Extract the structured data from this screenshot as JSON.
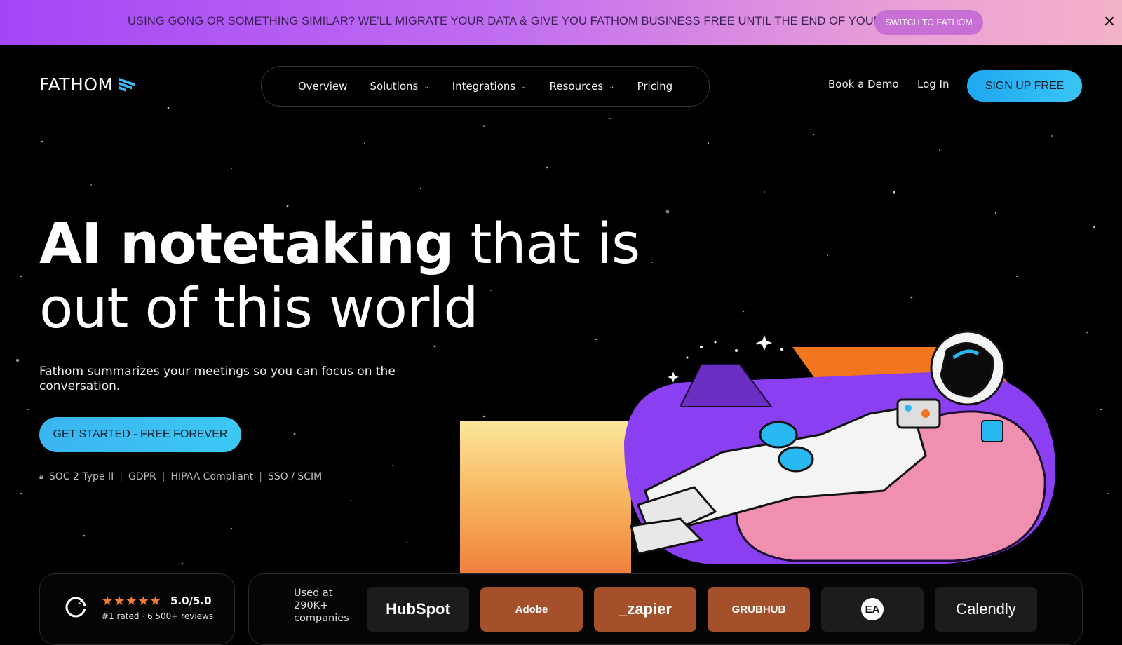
{
  "banner": {
    "text": "USING GONG OR SOMETHING SIMILAR? WE'LL MIGRATE YOUR DATA & GIVE YOU FATHOM BUSINESS FREE UNTIL THE END OF YOUR CONTRACT.",
    "button": "SWITCH TO FATHOM",
    "close": "✕"
  },
  "header": {
    "logo_text": "FATHOM",
    "nav": [
      {
        "label": "Overview",
        "dropdown": false
      },
      {
        "label": "Solutions",
        "dropdown": true
      },
      {
        "label": "Integrations",
        "dropdown": true
      },
      {
        "label": "Resources",
        "dropdown": true
      },
      {
        "label": "Pricing",
        "dropdown": false
      }
    ],
    "book_demo": "Book a Demo",
    "login": "Log In",
    "signup": "SIGN UP FREE"
  },
  "hero": {
    "title_bold": "AI notetaking",
    "title_light_1": " that is",
    "title_light_2": "out of this world",
    "subtitle": "Fathom summarizes your meetings so you can focus on the conversation.",
    "cta": "GET STARTED - FREE FOREVER",
    "compliance": [
      "SOC 2 Type II",
      "GDPR",
      "HIPAA Compliant",
      "SSO / SCIM"
    ]
  },
  "rating": {
    "stars": "★★★★★",
    "score": "5.0/5.0",
    "subtext": "#1 rated · 6,500+ reviews"
  },
  "companies": {
    "label": "Used at 290K+ companies",
    "logos": [
      "HubSpot",
      "Adobe",
      "_zapier",
      "GRUBHUB",
      "EA",
      "Calendly"
    ]
  },
  "colors": {
    "accent_blue": "#39c6f5",
    "banner_purple": "#a347f5",
    "banner_pink": "#f3b3c8"
  }
}
